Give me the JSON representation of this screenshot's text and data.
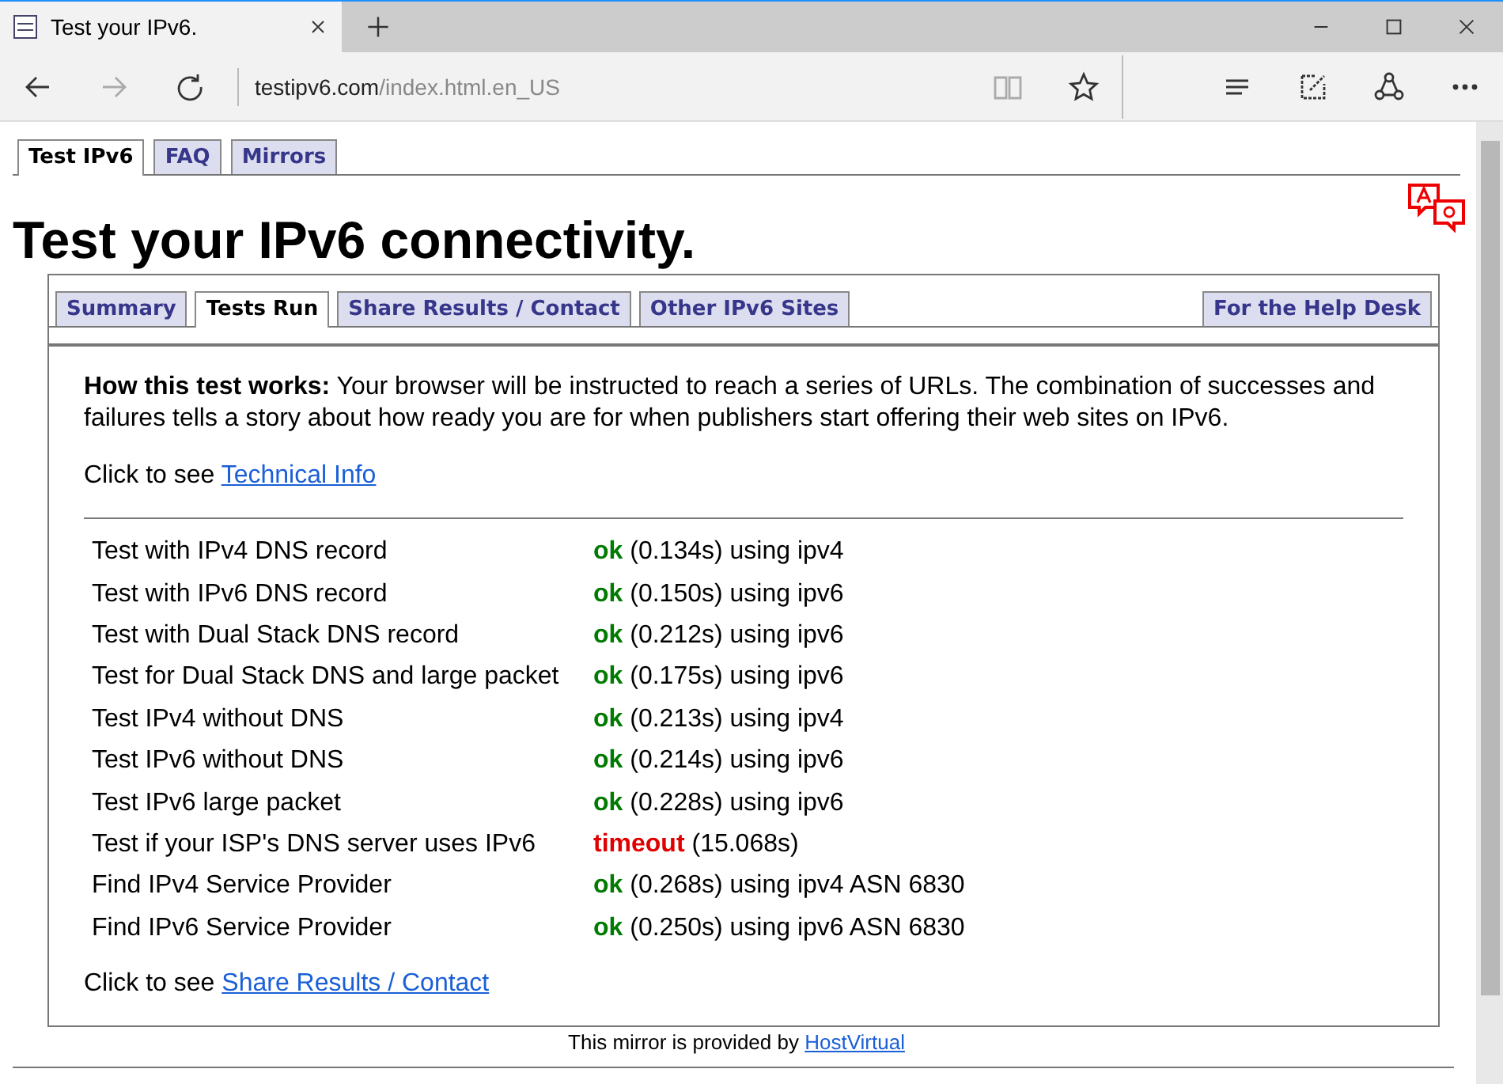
{
  "browser": {
    "tab_title": "Test your IPv6.",
    "url_domain": "testipv6.com",
    "url_path": "/index.html.en_US"
  },
  "top_tabs": [
    {
      "label": "Test IPv6",
      "selected": true
    },
    {
      "label": "FAQ",
      "selected": false
    },
    {
      "label": "Mirrors",
      "selected": false
    }
  ],
  "heading": "Test your IPv6 connectivity.",
  "inner_tabs": [
    {
      "label": "Summary",
      "selected": false
    },
    {
      "label": "Tests Run",
      "selected": true
    },
    {
      "label": "Share Results / Contact",
      "selected": false
    },
    {
      "label": "Other IPv6 Sites",
      "selected": false
    }
  ],
  "help_tab": {
    "label": "For the Help Desk",
    "selected": false
  },
  "intro": "**How this test works:** Your browser will be instructed to reach a series of URLs. The combination of successes and failures tells a story about how ready you are for when publishers start offering their web sites on IPv6.",
  "tech_info": {
    "prefix": "Click to see",
    "link": "Technical Info"
  },
  "results": [
    {
      "test": "Test with IPv4 DNS record",
      "kind": "ok",
      "status": "ok",
      "detail": "(0.134s) using ipv4"
    },
    {
      "test": "Test with IPv6 DNS record",
      "kind": "ok",
      "status": "ok",
      "detail": "(0.150s) using ipv6"
    },
    {
      "test": "Test with Dual Stack DNS record",
      "kind": "ok",
      "status": "ok",
      "detail": "(0.212s) using ipv6"
    },
    {
      "test": "Test for Dual Stack DNS and large packet",
      "kind": "ok",
      "status": "ok",
      "detail": "(0.175s) using ipv6"
    },
    {
      "test": "Test IPv4 without DNS",
      "kind": "ok",
      "status": "ok",
      "detail": "(0.213s) using ipv4"
    },
    {
      "test": "Test IPv6 without DNS",
      "kind": "ok",
      "status": "ok",
      "detail": "(0.214s) using ipv6"
    },
    {
      "test": "Test IPv6 large packet",
      "kind": "ok",
      "status": "ok",
      "detail": "(0.228s) using ipv6"
    },
    {
      "test": "Test if your ISP's DNS server uses IPv6",
      "kind": "fail",
      "status": "timeout",
      "detail": "(15.068s)"
    },
    {
      "test": "Find IPv4 Service Provider",
      "kind": "ok",
      "status": "ok",
      "detail": "(0.268s) using ipv4 ASN 6830"
    },
    {
      "test": "Find IPv6 Service Provider",
      "kind": "ok",
      "status": "ok",
      "detail": "(0.250s) using ipv6 ASN 6830"
    }
  ],
  "share_info": {
    "prefix": "Click to see",
    "link": "Share Results / Contact"
  },
  "footer": {
    "text": "This mirror is provided by",
    "link": "HostVirtual"
  }
}
